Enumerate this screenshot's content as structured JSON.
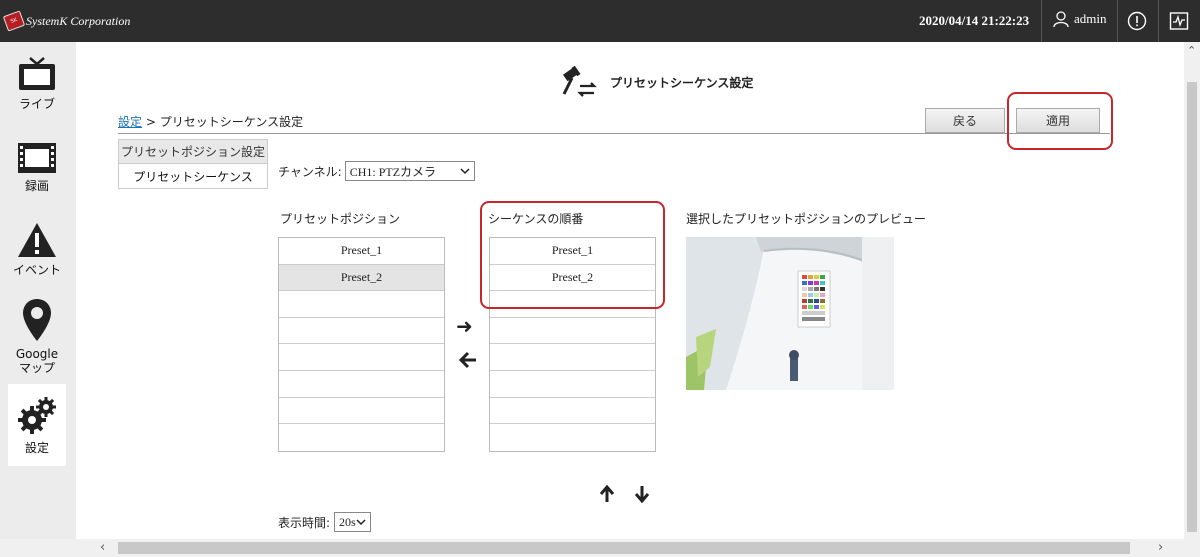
{
  "header": {
    "brand": "SystemK Corporation",
    "datetime": "2020/04/14 21:22:23",
    "user": "admin"
  },
  "sidebar": {
    "items": [
      {
        "label": "ライブ",
        "icon": "tv-icon"
      },
      {
        "label": "録画",
        "icon": "film-icon"
      },
      {
        "label": "イベント",
        "icon": "warning-icon"
      },
      {
        "label": "Google\nマップ",
        "icon": "map-pin-icon"
      },
      {
        "label": "設定",
        "icon": "gears-icon"
      }
    ]
  },
  "page": {
    "title": "プリセットシーケンス設定",
    "breadcrumb_link": "設定",
    "breadcrumb_sep": " > ",
    "breadcrumb_current": "プリセットシーケンス設定",
    "back_label": "戻る",
    "apply_label": "適用"
  },
  "tabs": [
    "プリセットポジション設定",
    "プリセットシーケンス"
  ],
  "channel": {
    "label": "チャンネル:",
    "value": "CH1: PTZカメラ"
  },
  "preset_positions": {
    "label": "プリセットポジション",
    "rows": [
      "Preset_1",
      "Preset_2",
      "",
      "",
      "",
      "",
      "",
      ""
    ]
  },
  "sequence": {
    "label": "シーケンスの順番",
    "rows": [
      "Preset_1",
      "Preset_2",
      "",
      "",
      "",
      "",
      "",
      ""
    ]
  },
  "preview": {
    "label": "選択したプリセットポジションのプレビュー"
  },
  "duration": {
    "label": "表示時間:",
    "value": "20s"
  },
  "colors": {
    "topbar": "#2d2d2d",
    "highlight": "#c8262d",
    "link": "#1a73b5"
  }
}
